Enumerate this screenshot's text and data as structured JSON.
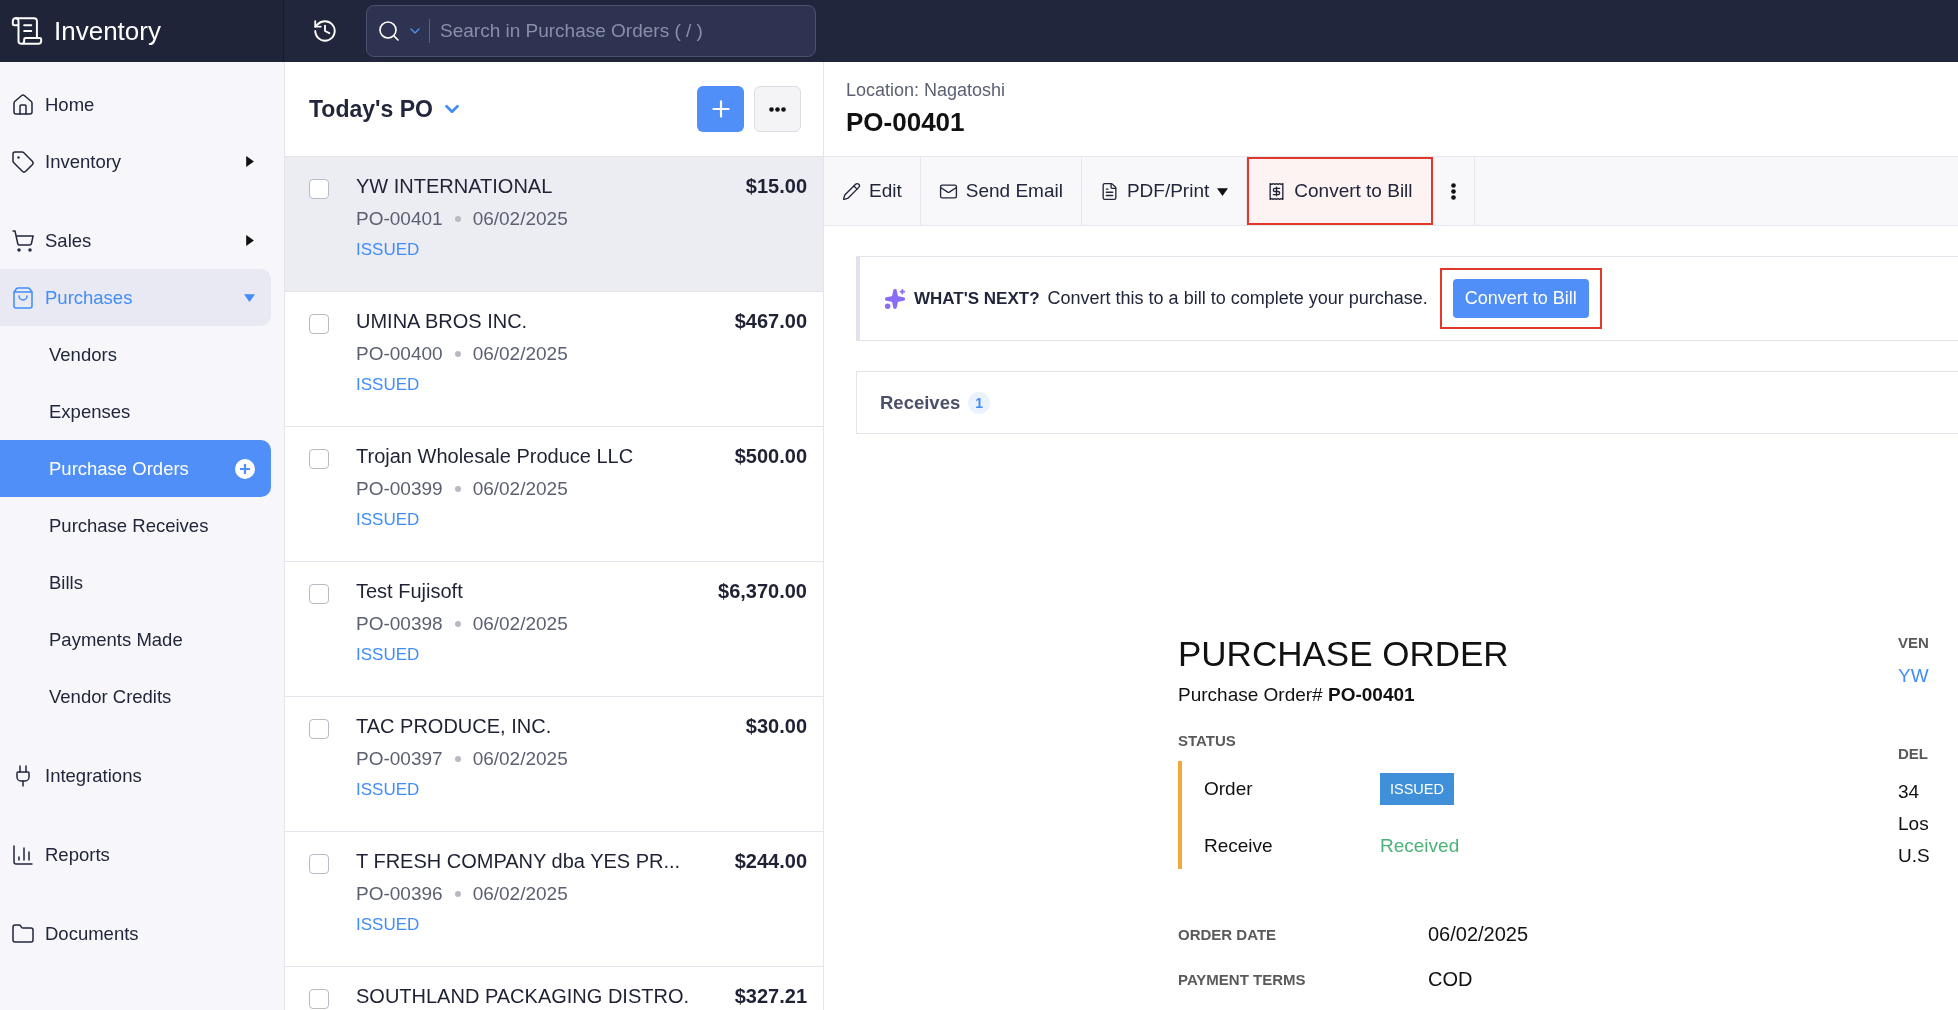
{
  "app": {
    "name": "Inventory"
  },
  "search": {
    "placeholder": "Search in Purchase Orders ( / )"
  },
  "sidebar": {
    "groups": [
      [
        {
          "label": "Home",
          "selected": false
        },
        {
          "label": "Inventory",
          "selected": false,
          "expanded": false
        }
      ],
      [
        {
          "label": "Sales",
          "selected": false,
          "expanded": false
        },
        {
          "label": "Purchases",
          "selected": true,
          "expanded": true,
          "children": [
            {
              "label": "Vendors",
              "selected": false
            },
            {
              "label": "Expenses",
              "selected": false
            },
            {
              "label": "Purchase Orders",
              "selected": true
            },
            {
              "label": "Purchase Receives",
              "selected": false
            },
            {
              "label": "Bills",
              "selected": false
            },
            {
              "label": "Payments Made",
              "selected": false
            },
            {
              "label": "Vendor Credits",
              "selected": false
            }
          ]
        }
      ],
      [
        {
          "label": "Integrations",
          "selected": false
        }
      ],
      [
        {
          "label": "Reports",
          "selected": false
        }
      ],
      [
        {
          "label": "Documents",
          "selected": false
        }
      ]
    ]
  },
  "list": {
    "title": "Today's PO",
    "rows": [
      {
        "name": "YW INTERNATIONAL",
        "amount": "$15.00",
        "number": "PO-00401",
        "date": "06/02/2025",
        "status": "ISSUED",
        "selected": true,
        "checked": false
      },
      {
        "name": "UMINA BROS INC.",
        "amount": "$467.00",
        "number": "PO-00400",
        "date": "06/02/2025",
        "status": "ISSUED",
        "selected": false,
        "checked": false
      },
      {
        "name": "Trojan Wholesale Produce LLC",
        "amount": "$500.00",
        "number": "PO-00399",
        "date": "06/02/2025",
        "status": "ISSUED",
        "selected": false,
        "checked": false
      },
      {
        "name": "Test Fujisoft",
        "amount": "$6,370.00",
        "number": "PO-00398",
        "date": "06/02/2025",
        "status": "ISSUED",
        "selected": false,
        "checked": false
      },
      {
        "name": "TAC PRODUCE, INC.",
        "amount": "$30.00",
        "number": "PO-00397",
        "date": "06/02/2025",
        "status": "ISSUED",
        "selected": false,
        "checked": false
      },
      {
        "name": "T FRESH COMPANY dba YES PR...",
        "amount": "$244.00",
        "number": "PO-00396",
        "date": "06/02/2025",
        "status": "ISSUED",
        "selected": false,
        "checked": false
      },
      {
        "name": "SOUTHLAND PACKAGING DISTRO.",
        "amount": "$327.21",
        "selected": false,
        "checked": false
      }
    ]
  },
  "detail": {
    "location": "Location: Nagatoshi",
    "number": "PO-00401",
    "toolbar": [
      {
        "kind": "edit",
        "label": "Edit",
        "highlighted": false
      },
      {
        "kind": "email",
        "label": "Send Email",
        "highlighted": false
      },
      {
        "kind": "pdf",
        "label": "PDF/Print",
        "highlighted": false
      },
      {
        "kind": "bill",
        "label": "Convert to Bill",
        "highlighted": true
      },
      {
        "kind": "more",
        "highlighted": false
      }
    ],
    "banner": {
      "heading": "WHAT'S NEXT?",
      "text": "Convert this to a bill to complete your purchase.",
      "button": "Convert to Bill",
      "highlighted": true
    },
    "receives": {
      "label": "Receives",
      "count": "1"
    },
    "document": {
      "title": "PURCHASE ORDER",
      "number_line": "Purchase Order# **PO-00401**",
      "status_heading": "STATUS",
      "status_rows": [
        {
          "label": "Order",
          "value": "ISSUED",
          "kind": "badge"
        },
        {
          "label": "Receive",
          "value": "Received",
          "kind": "text"
        }
      ],
      "fields": [
        {
          "label": "ORDER DATE",
          "value": "06/02/2025"
        },
        {
          "label": "PAYMENT TERMS",
          "value": "COD"
        }
      ],
      "vendor_label": "VEN",
      "vendor_link": "YW",
      "delivery_label": "DEL",
      "address": [
        "34",
        "Los",
        "U.S"
      ]
    }
  }
}
